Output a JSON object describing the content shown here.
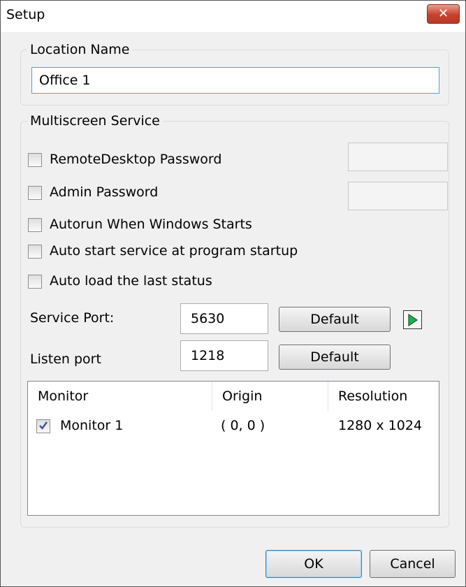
{
  "window": {
    "title": "Setup",
    "close_icon": "close-icon"
  },
  "location": {
    "group_label": "Location Name",
    "name_value": "Office 1"
  },
  "service": {
    "group_label": "Multiscreen Service",
    "options": [
      {
        "label": "RemoteDesktop Password",
        "checked": false
      },
      {
        "label": "Admin Password",
        "checked": false
      },
      {
        "label": "Autorun When Windows Starts",
        "checked": false
      },
      {
        "label": "Auto start service at program startup",
        "checked": false
      },
      {
        "label": "Auto load the last status",
        "checked": false
      }
    ],
    "remote_password_value": "",
    "admin_password_value": "",
    "service_port_label": "Service Port:",
    "service_port_value": "5630",
    "listen_port_label": "Listen port",
    "listen_port_value": "1218",
    "default_label": "Default",
    "arrow_icon": "play-arrow-icon"
  },
  "monitors": {
    "columns": [
      "Monitor",
      "Origin",
      "Resolution"
    ],
    "rows": [
      {
        "checked": true,
        "monitor": "Monitor 1",
        "origin": "( 0, 0 )",
        "resolution": "1280 x 1024"
      }
    ]
  },
  "footer": {
    "ok_label": "OK",
    "cancel_label": "Cancel"
  },
  "colors": {
    "close_button": "#c7412b",
    "focus_border": "#569de5",
    "arrow_green": "#21b24b"
  }
}
